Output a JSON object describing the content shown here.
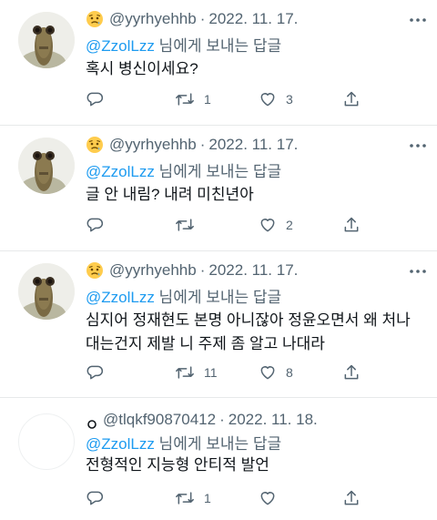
{
  "tweets": [
    {
      "handle": "@yyrhyehhb",
      "separator": "·",
      "date": "2022. 11. 17.",
      "reply_prefix": "",
      "reply_mention": "@ZzolLzz",
      "reply_suffix": " 님에게 보내는 답글",
      "text": "혹시 병신이세요?",
      "reply_count": "",
      "retweet_count": "1",
      "like_count": "3",
      "share_count": ""
    },
    {
      "handle": "@yyrhyehhb",
      "separator": "·",
      "date": "2022. 11. 17.",
      "reply_mention": "@ZzolLzz",
      "reply_suffix": " 님에게 보내는 답글",
      "text": "글 안 내림? 내려 미친년아",
      "reply_count": "",
      "retweet_count": "",
      "like_count": "2",
      "share_count": ""
    },
    {
      "handle": "@yyrhyehhb",
      "separator": "·",
      "date": "2022. 11. 17.",
      "reply_mention": "@ZzolLzz",
      "reply_suffix": " 님에게 보내는 답글",
      "text": "심지어 정재현도 본명 아니잖아 정윤오면서 왜 처나대는건지 제발 니 주제 좀 알고 나대라",
      "reply_count": "",
      "retweet_count": "11",
      "like_count": "8",
      "share_count": ""
    },
    {
      "handle": "@tlqkf90870412",
      "separator": "·",
      "date": "2022. 11. 18.",
      "reply_mention": "@ZzolLzz",
      "reply_suffix": " 님에게 보내는 답글",
      "text": "전형적인 지능형 안티적 발언",
      "reply_count": "",
      "retweet_count": "1",
      "like_count": "",
      "share_count": ""
    }
  ],
  "icons": {
    "emoji": "sad-face-emoji",
    "more": "more-dots-icon",
    "reply": "reply-icon",
    "retweet": "retweet-icon",
    "like": "heart-icon",
    "share": "share-icon"
  },
  "colors": {
    "text": "#0f1419",
    "secondary": "#536471",
    "mention": "#1d9bf0",
    "divider": "#e7e9ea"
  }
}
